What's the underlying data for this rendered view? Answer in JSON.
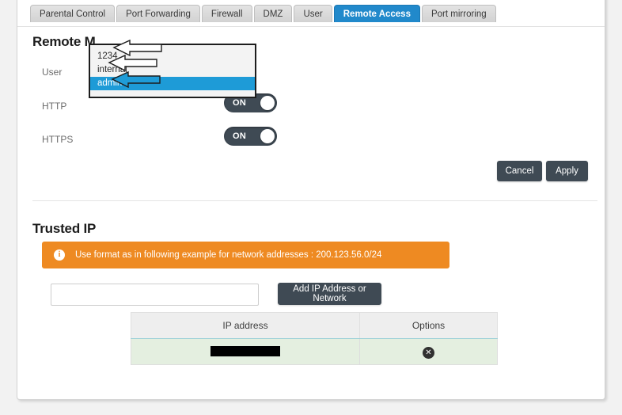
{
  "tabs": [
    {
      "label": "Parental Control",
      "active": false
    },
    {
      "label": "Port Forwarding",
      "active": false
    },
    {
      "label": "Firewall",
      "active": false
    },
    {
      "label": "DMZ",
      "active": false
    },
    {
      "label": "User",
      "active": false
    },
    {
      "label": "Remote Access",
      "active": true
    },
    {
      "label": "Port mirroring",
      "active": false
    }
  ],
  "remote_section": {
    "title": "Remote M",
    "user_label": "User",
    "http_label": "HTTP",
    "https_label": "HTTPS",
    "http_state": "ON",
    "https_state": "ON",
    "cancel_label": "Cancel",
    "apply_label": "Apply"
  },
  "user_dropdown": {
    "options": [
      {
        "label": "1234",
        "selected": false
      },
      {
        "label": "internal",
        "selected": false
      },
      {
        "label": "admin",
        "selected": true
      }
    ],
    "selected_value": "admin"
  },
  "trusted_section": {
    "title": "Trusted IP",
    "info_icon": "info-icon",
    "info_text": "Use format as in following example for network addresses : 200.123.56.0/24",
    "input_value": "",
    "input_placeholder": "",
    "add_button_label": "Add IP Address or Network",
    "table": {
      "headers": [
        "IP address",
        "Options"
      ],
      "rows": [
        {
          "ip": "",
          "ip_redacted": true,
          "option_icon": "delete-circle-icon"
        }
      ]
    }
  },
  "colors": {
    "accent_blue": "#2189cb",
    "highlight_blue": "#1e9bd7",
    "dark_slate": "#3f4a54",
    "orange": "#ee8a22",
    "row_green": "#e4efe0"
  }
}
